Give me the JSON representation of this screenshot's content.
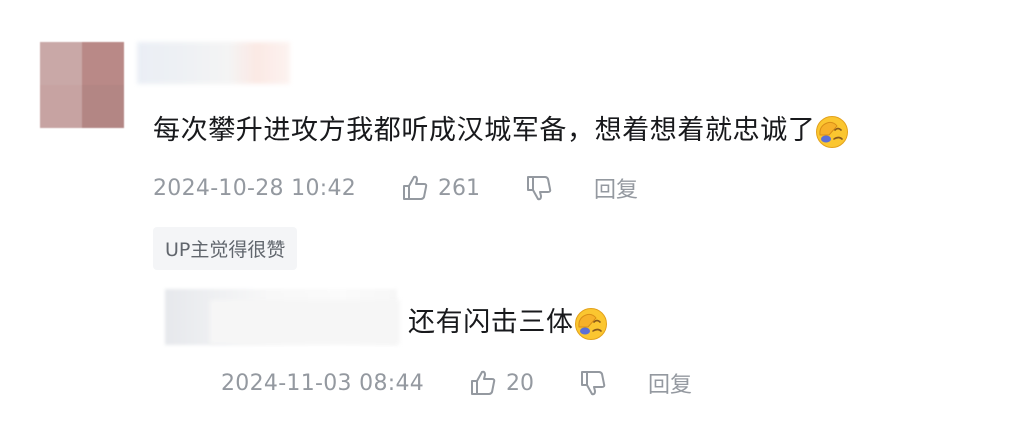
{
  "comment": {
    "text": "每次攀升进攻方我都听成汉城军备，想着想着就忠诚了",
    "emoji": "facepalm-emoji",
    "time": "2024-10-28 10:42",
    "likes": "261",
    "reply_label": "回复",
    "up_badge": "UP主觉得很赞"
  },
  "sub_reply": {
    "text": "还有闪击三体",
    "emoji": "facepalm-emoji",
    "time": "2024-11-03 08:44",
    "likes": "20",
    "reply_label": "回复"
  },
  "colors": {
    "text": "#18191c",
    "meta": "#9499a0",
    "badge_bg": "#f4f5f7"
  }
}
